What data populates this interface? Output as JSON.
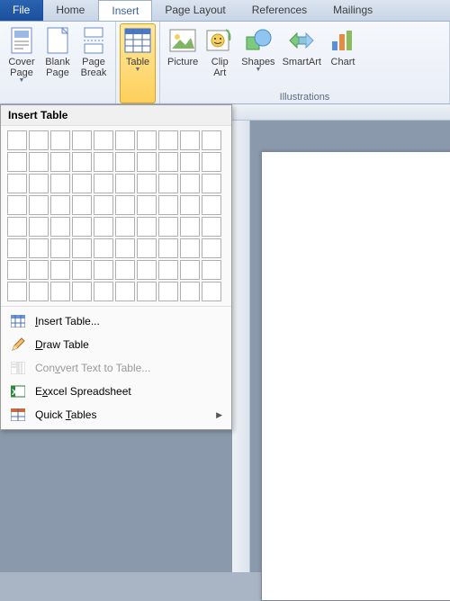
{
  "tabs": {
    "file": "File",
    "home": "Home",
    "insert": "Insert",
    "pagelayout": "Page Layout",
    "references": "References",
    "mailings": "Mailings"
  },
  "ribbon": {
    "cover_page": "Cover\nPage",
    "blank_page": "Blank\nPage",
    "page_break": "Page\nBreak",
    "table": "Table",
    "picture": "Picture",
    "clip_art": "Clip\nArt",
    "shapes": "Shapes",
    "smartart": "SmartArt",
    "chart": "Chart",
    "illustrations_label": "Illustrations"
  },
  "dropdown": {
    "header": "Insert Table",
    "grid_rows": 8,
    "grid_cols": 10,
    "items": {
      "insert_table": "nsert Table...",
      "draw_table": "raw Table",
      "convert": "vert Text to Table...",
      "excel": "xcel Spreadsheet",
      "quick": "ables"
    }
  }
}
